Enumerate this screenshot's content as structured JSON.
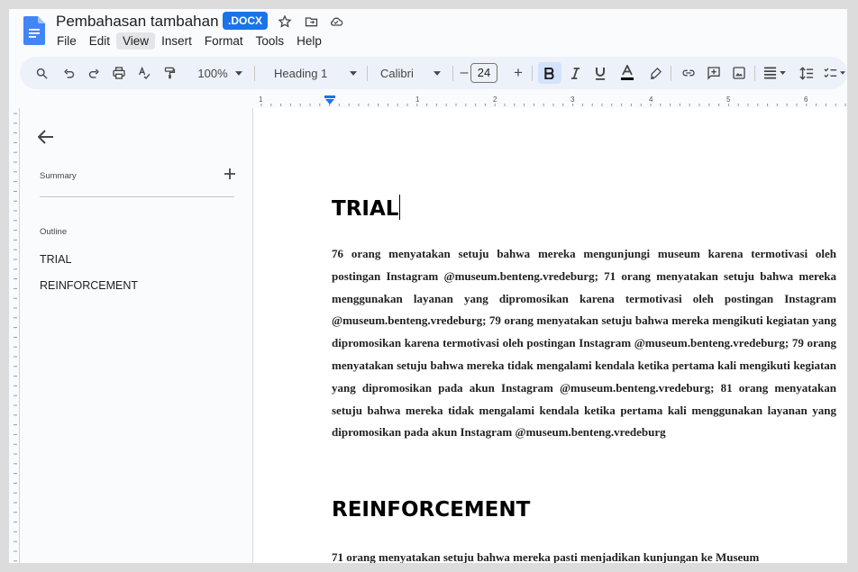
{
  "document": {
    "title": "Pembahasan tambahan",
    "badge": "DOCX"
  },
  "menu": {
    "items": [
      "File",
      "Edit",
      "View",
      "Insert",
      "Format",
      "Tools",
      "Help"
    ]
  },
  "toolbar": {
    "zoom": "100%",
    "style": "Heading 1",
    "font": "Calibri",
    "font_size": "24",
    "minus": "–",
    "plus": "+"
  },
  "ruler": {
    "numbers": [
      "1",
      "1",
      "2",
      "3",
      "4",
      "5",
      "6"
    ]
  },
  "sidebar": {
    "summary_label": "Summary",
    "outline_label": "Outline",
    "outline_items": [
      "TRIAL",
      "REINFORCEMENT"
    ]
  },
  "content": {
    "heading1": "TRIAL",
    "paragraph1": "76 orang menyatakan setuju bahwa mereka mengunjungi museum karena termotivasi oleh postingan Instagram @museum.benteng.vredeburg; 71 orang menyatakan setuju bahwa mereka menggunakan layanan yang dipromosikan karena termotivasi oleh postingan Instagram @museum.benteng.vredeburg; 79 orang menyatakan setuju bahwa mereka mengikuti kegiatan yang dipromosikan karena termotivasi oleh postingan Instagram @museum.benteng.vredeburg; 79 orang menyatakan setuju bahwa mereka tidak mengalami kendala ketika pertama kali mengikuti kegiatan yang dipromosikan pada akun Instagram @museum.benteng.vredeburg; 81 orang menyatakan setuju bahwa mereka tidak mengalami kendala ketika pertama kali menggunakan layanan yang dipromosikan pada akun Instagram @museum.benteng.vredeburg",
    "heading2": "REINFORCEMENT",
    "paragraph2": "71 orang menyatakan setuju bahwa mereka pasti menjadikan kunjungan ke Museum"
  },
  "colors": {
    "accent": "#1a73e8",
    "toolbar_bg": "#edf2fa",
    "app_bg": "#f9fbfd"
  }
}
